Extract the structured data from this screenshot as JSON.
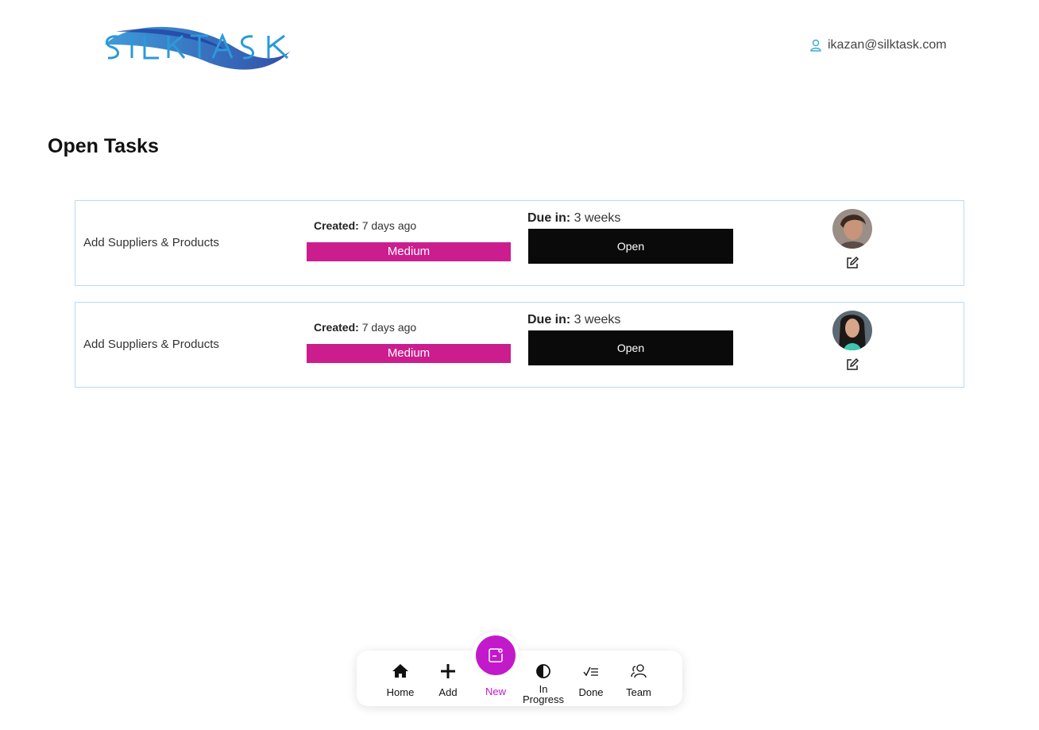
{
  "header": {
    "logo_text": "SILKTASK",
    "user_email": "ikazan@silktask.com",
    "user_icon": "user-icon"
  },
  "page": {
    "title": "Open Tasks"
  },
  "tasks": [
    {
      "name": "Add Suppliers & Products",
      "created_label": "Created:",
      "created_value": "7 days ago",
      "priority": "Medium",
      "due_label": "Due in:",
      "due_value": "3 weeks",
      "status": "Open"
    },
    {
      "name": "Add Suppliers & Products",
      "created_label": "Created:",
      "created_value": "7 days ago",
      "priority": "Medium",
      "due_label": "Due in:",
      "due_value": "3 weeks",
      "status": "Open"
    }
  ],
  "nav": {
    "items": [
      {
        "label": "Home",
        "icon": "home-icon"
      },
      {
        "label": "Add",
        "icon": "plus-icon"
      },
      {
        "label": "New",
        "icon": "new-task-icon"
      },
      {
        "label": "In Progress",
        "icon": "half-circle-icon"
      },
      {
        "label": "Done",
        "icon": "checklist-icon"
      },
      {
        "label": "Team",
        "icon": "team-icon"
      }
    ]
  },
  "colors": {
    "priority_medium": "#cc1d8f",
    "accent": "#c21aca",
    "status_open": "#0a0a0a",
    "card_border": "#b9dcef"
  }
}
